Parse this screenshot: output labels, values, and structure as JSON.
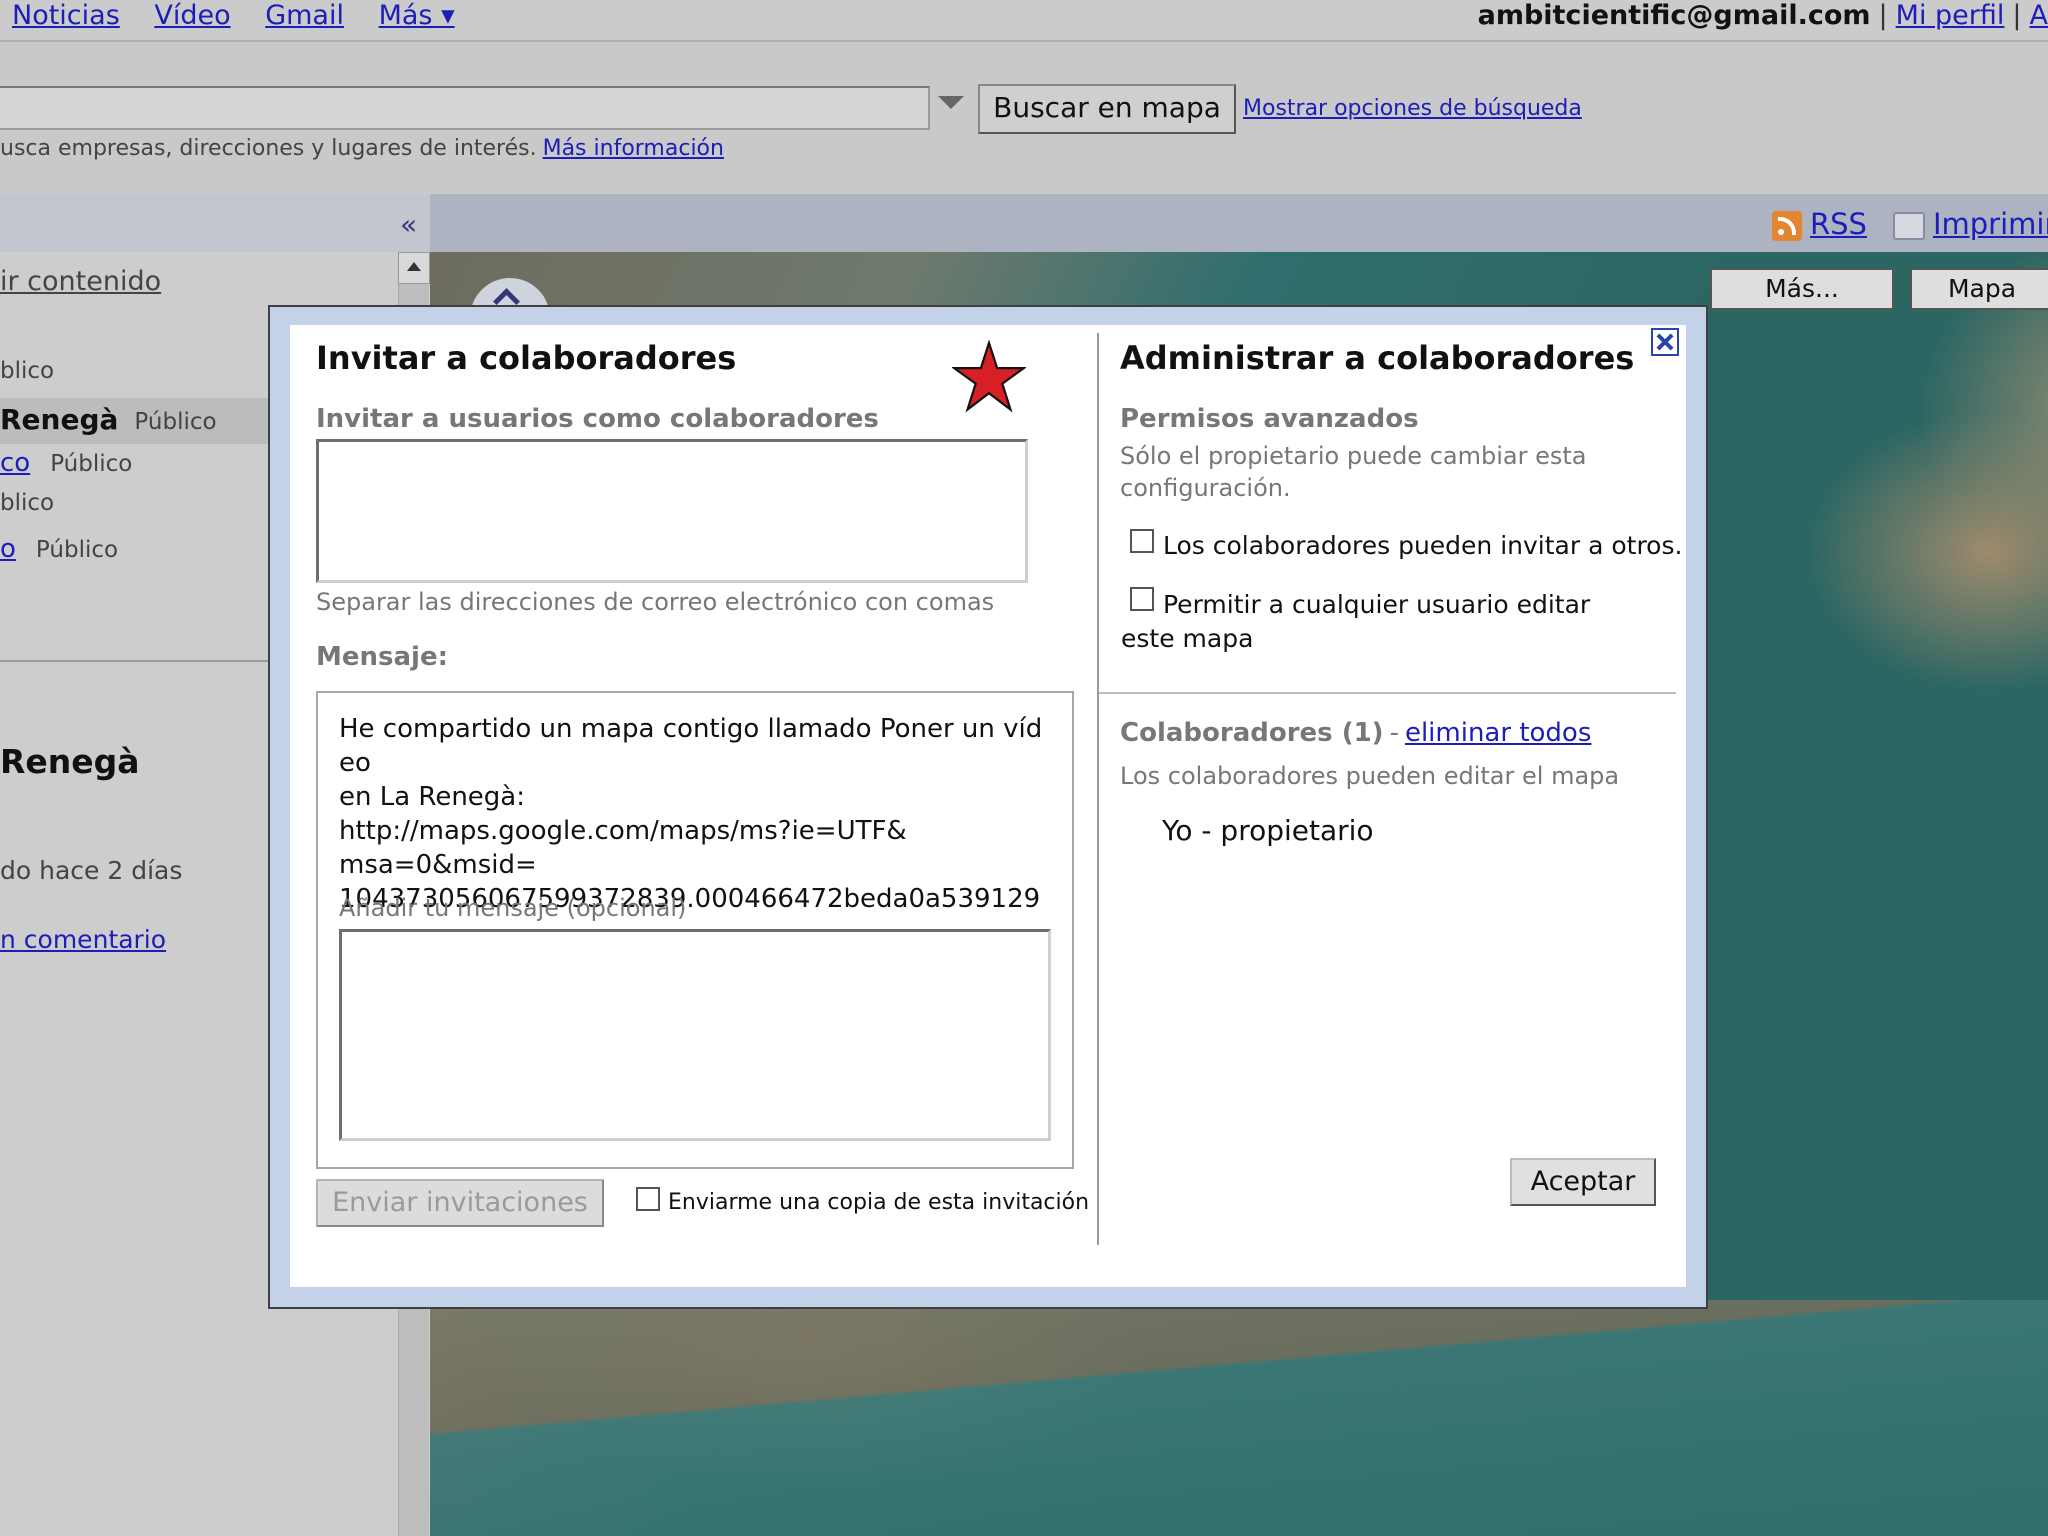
{
  "top_bar": {
    "nav": [
      "Noticias",
      "Vídeo",
      "Gmail",
      "Más ▾"
    ],
    "user_email": "ambitcientific@gmail.com",
    "separator": "|",
    "profile_link": "Mi perfil",
    "truncated_link": "A"
  },
  "search": {
    "button_label": "Buscar en mapa",
    "options_link": "Mostrar opciones de búsqueda",
    "hint_text": "usca empresas, direcciones y lugares de interés.",
    "hint_link": "Más información"
  },
  "panel": {
    "collapse_label": "«",
    "rss_label": "RSS",
    "print_label": "Imprimir"
  },
  "sidebar": {
    "edit_link": "ir contenido",
    "rows": [
      {
        "title": "",
        "visibility": "blico"
      },
      {
        "title": "Renegà",
        "visibility": "Público"
      },
      {
        "title": "co",
        "visibility": "Público"
      },
      {
        "title": "",
        "visibility": "blico"
      },
      {
        "title": "o",
        "visibility": "Público"
      }
    ],
    "map_title": "Renegà",
    "date_text": "do hace 2 días",
    "comment_link": "n comentario"
  },
  "map_controls": {
    "more_label": "Más...",
    "map_label": "Mapa"
  },
  "dialog": {
    "invite_title": "Invitar a colaboradores",
    "invite_subtitle": "Invitar a usuarios como colaboradores",
    "invite_input_value": "",
    "invite_hint": "Separar las direcciones de correo electrónico con comas",
    "message_label": "Mensaje:",
    "message_text": "He compartido un mapa contigo llamado Poner un vídeo\nen La Renegà:\nhttp://maps.google.com/maps/ms?ie=UTF&\nmsa=0&msid=\n104373056067599372839.000466472beda0a539129",
    "optional_label": "Añadir tu mensaje (opcional)",
    "optional_input_value": "",
    "send_button": "Enviar invitaciones",
    "copy_checkbox_label": "Enviarme una copia de esta invitación",
    "manage_title": "Administrar a colaboradores",
    "permissions_title": "Permisos avanzados",
    "permissions_note": "Sólo el propietario puede cambiar esta configuración.",
    "permission_1": "Los colaboradores pueden invitar a otros.",
    "permission_2": "Permitir a cualquier usuario editar este mapa",
    "collaborators_label": "Colaboradores (1)",
    "collaborators_dash": "-",
    "remove_all_link": "eliminar todos",
    "collaborators_note": "Los colaboradores pueden editar el mapa",
    "owner_entry": "Yo - propietario",
    "accept_button": "Aceptar",
    "star_color": "#d81f26"
  }
}
